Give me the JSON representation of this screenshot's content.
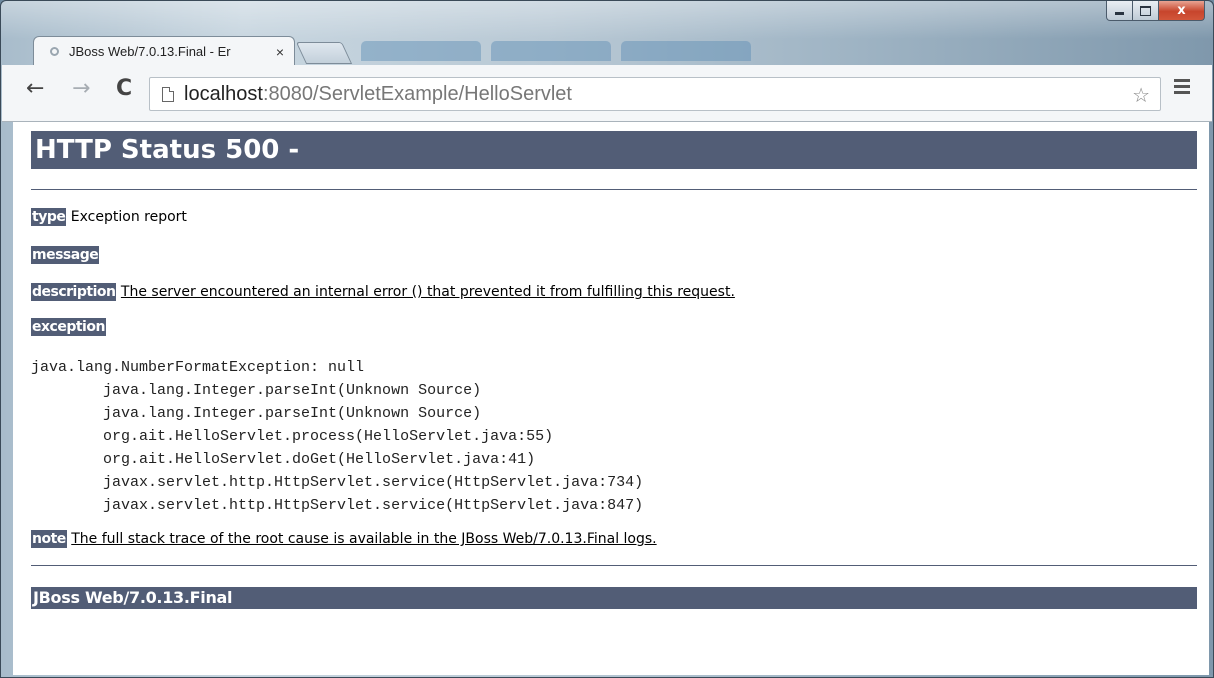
{
  "browser": {
    "tab": {
      "title": "JBoss Web/7.0.13.Final - Er",
      "close_glyph": "×"
    },
    "address": {
      "host": "localhost",
      "path": ":8080/ServletExample/HelloServlet"
    },
    "icons": {
      "back": "←",
      "forward": "→",
      "reload": "C",
      "star": "☆",
      "close_window": "x"
    }
  },
  "page": {
    "title": "HTTP Status 500 -",
    "type": {
      "label": "type",
      "value": "Exception report"
    },
    "message": {
      "label": "message"
    },
    "description": {
      "label": "description",
      "value": "The server encountered an internal error () that prevented it from fulfilling this request."
    },
    "exception": {
      "label": "exception"
    },
    "stack_trace": "java.lang.NumberFormatException: null\n\tjava.lang.Integer.parseInt(Unknown Source)\n\tjava.lang.Integer.parseInt(Unknown Source)\n\torg.ait.HelloServlet.process(HelloServlet.java:55)\n\torg.ait.HelloServlet.doGet(HelloServlet.java:41)\n\tjavax.servlet.http.HttpServlet.service(HttpServlet.java:734)\n\tjavax.servlet.http.HttpServlet.service(HttpServlet.java:847)",
    "note": {
      "label": "note",
      "value": "The full stack trace of the root cause is available in the JBoss Web/7.0.13.Final logs."
    },
    "footer": "JBoss Web/7.0.13.Final"
  },
  "colors": {
    "header_bg": "#525d76",
    "header_text": "#ffffff"
  }
}
